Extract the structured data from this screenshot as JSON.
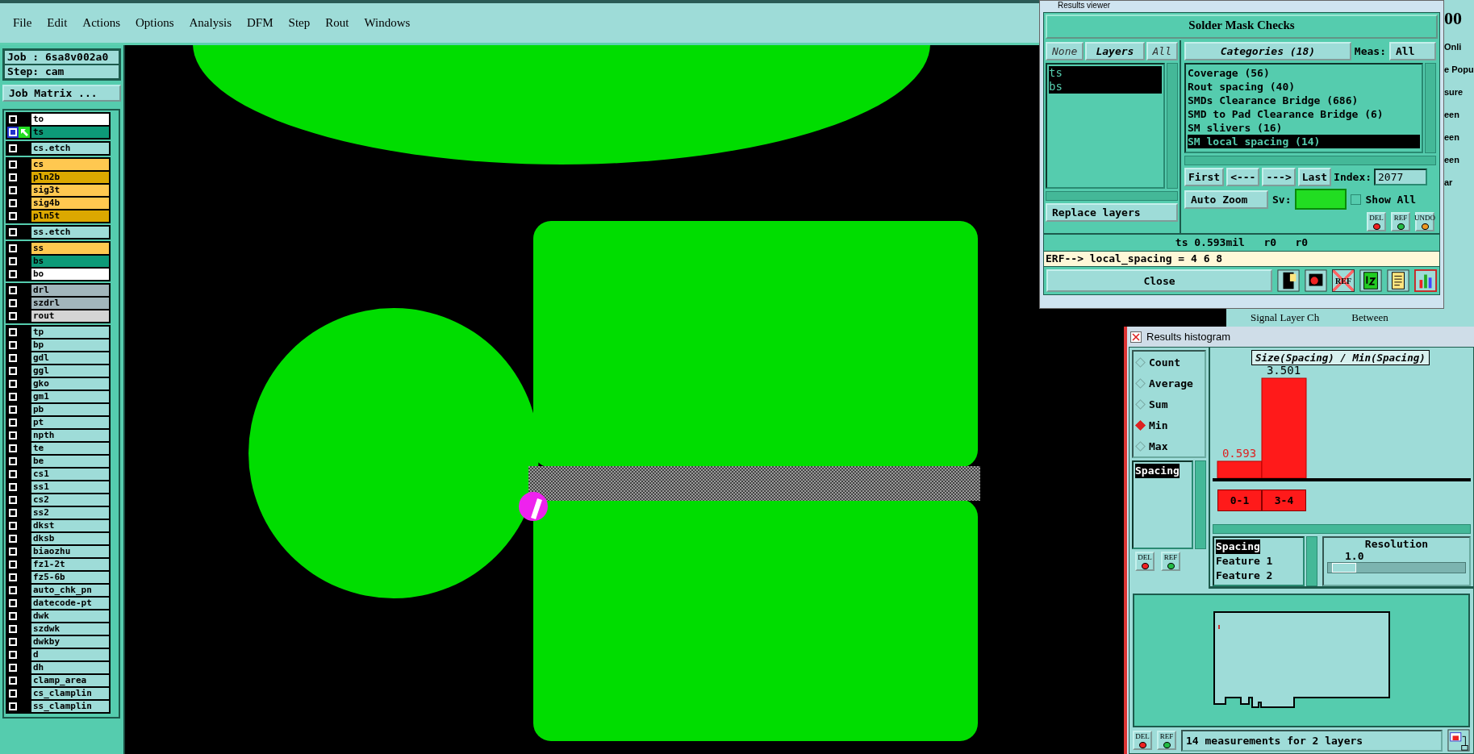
{
  "menu": [
    "File",
    "Edit",
    "Actions",
    "Options",
    "Analysis",
    "DFM",
    "Step",
    "Rout",
    "Windows"
  ],
  "job": "Job : 6sa8v002a0",
  "step": "Step: cam",
  "job_matrix_button": "Job Matrix ...",
  "layer_groups": [
    {
      "layers": [
        {
          "name": "to",
          "color": "#ffffff",
          "selected": false
        },
        {
          "name": "ts",
          "color": "#0d9a78",
          "selected": true
        }
      ]
    },
    {
      "layers": [
        {
          "name": "cs.etch",
          "color": "#9edcd8",
          "selected": false
        }
      ]
    },
    {
      "layers": [
        {
          "name": "cs",
          "color": "#ffc850",
          "selected": false
        },
        {
          "name": "pln2b",
          "color": "#dca800",
          "selected": false
        },
        {
          "name": "sig3t",
          "color": "#ffc850",
          "selected": false
        },
        {
          "name": "sig4b",
          "color": "#ffc850",
          "selected": false
        },
        {
          "name": "pln5t",
          "color": "#dca800",
          "selected": false
        }
      ]
    },
    {
      "layers": [
        {
          "name": "ss.etch",
          "color": "#9edcd8",
          "selected": false
        }
      ]
    },
    {
      "layers": [
        {
          "name": "ss",
          "color": "#ffc850",
          "selected": false
        },
        {
          "name": "bs",
          "color": "#0d9a78",
          "selected": false
        },
        {
          "name": "bo",
          "color": "#ffffff",
          "selected": false
        }
      ]
    },
    {
      "layers": [
        {
          "name": "drl",
          "color": "#a2b6bc",
          "selected": false
        },
        {
          "name": "szdrl",
          "color": "#a2b6bc",
          "selected": false
        },
        {
          "name": "rout",
          "color": "#d4d4d4",
          "selected": false
        }
      ]
    },
    {
      "layers": [
        {
          "name": "tp",
          "color": "#9edcd8",
          "selected": false
        },
        {
          "name": "bp",
          "color": "#9edcd8",
          "selected": false
        },
        {
          "name": "gdl",
          "color": "#9edcd8",
          "selected": false
        },
        {
          "name": "ggl",
          "color": "#9edcd8",
          "selected": false
        },
        {
          "name": "gko",
          "color": "#9edcd8",
          "selected": false
        },
        {
          "name": "gm1",
          "color": "#9edcd8",
          "selected": false
        },
        {
          "name": "pb",
          "color": "#9edcd8",
          "selected": false
        },
        {
          "name": "pt",
          "color": "#9edcd8",
          "selected": false
        },
        {
          "name": "npth",
          "color": "#9edcd8",
          "selected": false
        },
        {
          "name": "te",
          "color": "#9edcd8",
          "selected": false
        },
        {
          "name": "be",
          "color": "#9edcd8",
          "selected": false
        },
        {
          "name": "cs1",
          "color": "#9edcd8",
          "selected": false
        },
        {
          "name": "ss1",
          "color": "#9edcd8",
          "selected": false
        },
        {
          "name": "cs2",
          "color": "#9edcd8",
          "selected": false
        },
        {
          "name": "ss2",
          "color": "#9edcd8",
          "selected": false
        },
        {
          "name": "dkst",
          "color": "#9edcd8",
          "selected": false
        },
        {
          "name": "dksb",
          "color": "#9edcd8",
          "selected": false
        },
        {
          "name": "biaozhu",
          "color": "#9edcd8",
          "selected": false
        },
        {
          "name": "fz1-2t",
          "color": "#9edcd8",
          "selected": false
        },
        {
          "name": "fz5-6b",
          "color": "#9edcd8",
          "selected": false
        },
        {
          "name": "auto_chk_pn",
          "color": "#9edcd8",
          "selected": false
        },
        {
          "name": "datecode-pt",
          "color": "#9edcd8",
          "selected": false
        },
        {
          "name": "dwk",
          "color": "#9edcd8",
          "selected": false
        },
        {
          "name": "szdwk",
          "color": "#9edcd8",
          "selected": false
        },
        {
          "name": "dwkby",
          "color": "#9edcd8",
          "selected": false
        },
        {
          "name": "d",
          "color": "#9edcd8",
          "selected": false
        },
        {
          "name": "dh",
          "color": "#9edcd8",
          "selected": false
        },
        {
          "name": "clamp_area",
          "color": "#9edcd8",
          "selected": false
        },
        {
          "name": "cs_clamplin",
          "color": "#9edcd8",
          "selected": false
        },
        {
          "name": "ss_clamplin",
          "color": "#9edcd8",
          "selected": false
        }
      ]
    }
  ],
  "background_window": {
    "big_text": "00",
    "fragments": [
      "Onli",
      "e Popu",
      "sure",
      "een",
      "een",
      "een",
      "ar"
    ],
    "tabs": [
      "Signal Layer Ch",
      "Between"
    ]
  },
  "results_viewer": {
    "title": "Results viewer",
    "header": "Solder Mask Checks",
    "layer_buttons": [
      {
        "label": "None",
        "selected": false
      },
      {
        "label": "Layers",
        "selected": true
      },
      {
        "label": "All",
        "selected": false
      }
    ],
    "layers": [
      {
        "name": "ts",
        "selected": true
      },
      {
        "name": "bs",
        "selected": true
      }
    ],
    "categories_button": "Categories (18)",
    "meas_label": "Meas:",
    "meas_value": "All",
    "categories": [
      {
        "label": "Coverage (56)",
        "selected": false
      },
      {
        "label": "Rout spacing (40)",
        "selected": false
      },
      {
        "label": "SMDs Clearance Bridge (686)",
        "selected": false
      },
      {
        "label": "SMD to Pad Clearance Bridge (6)",
        "selected": false
      },
      {
        "label": "SM slivers (16)",
        "selected": false
      },
      {
        "label": "SM local spacing (14)",
        "selected": true
      }
    ],
    "nav_buttons": [
      "First",
      "<---",
      "--->",
      "Last"
    ],
    "index_label": "Index:",
    "index_value": "2077",
    "auto_zoom": "Auto Zoom",
    "sv_label": "Sv:",
    "show_all": {
      "label": "Show All",
      "checked": false
    },
    "replace_layers": "Replace layers",
    "action_buttons": [
      "DEL",
      "REF",
      "UNDO"
    ],
    "status": "ts 0.593mil   r0   r0",
    "erf": "ERF--> local_spacing = 4 6 8",
    "close": "Close",
    "crossed_ref_label": "REF"
  },
  "histogram": {
    "title": "Results histogram",
    "modes": [
      {
        "label": "Count",
        "selected": false
      },
      {
        "label": "Average",
        "selected": false
      },
      {
        "label": "Sum",
        "selected": false
      },
      {
        "label": "Min",
        "selected": true
      },
      {
        "label": "Max",
        "selected": false
      }
    ],
    "measures": [
      {
        "label": "Spacing",
        "selected": true
      }
    ],
    "list_buttons": [
      "DEL",
      "REF"
    ],
    "chart_data": {
      "type": "bar",
      "title": "Size(Spacing) / Min(Spacing)",
      "categories": [
        "0-1",
        "3-4"
      ],
      "values": [
        0.593,
        3.501
      ],
      "data_labels": true
    },
    "fields": [
      {
        "label": "Spacing",
        "selected": true
      },
      {
        "label": "Feature 1",
        "selected": false
      },
      {
        "label": "Feature 2",
        "selected": false
      }
    ],
    "resolution": {
      "label": "Resolution",
      "value": "1.0",
      "level": 0.03
    },
    "footer_buttons": [
      "DEL",
      "REF"
    ],
    "status": "14 measurements for 2 layers"
  }
}
